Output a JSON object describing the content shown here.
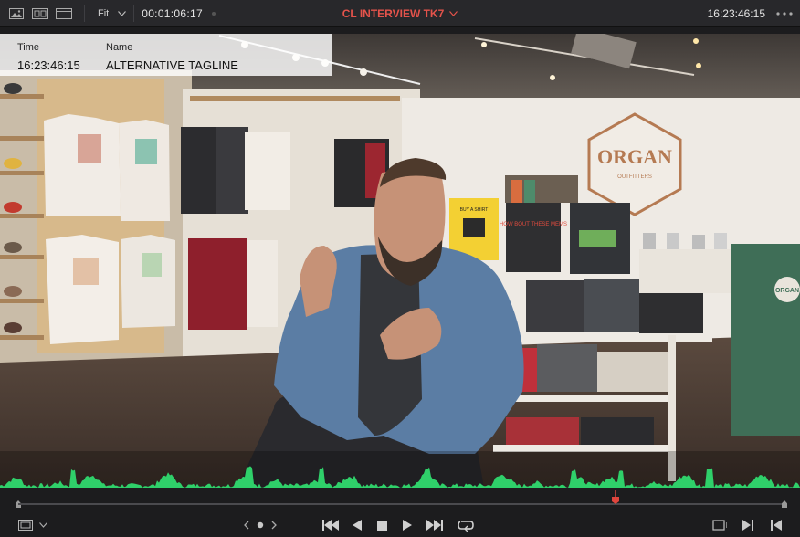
{
  "toolbar": {
    "zoom_label": "Fit",
    "source_timecode": "00:01:06:17",
    "clip_name": "CL INTERVIEW TK7",
    "record_timecode": "16:23:46:15"
  },
  "overlay": {
    "time_label": "Time",
    "time_value": "16:23:46:15",
    "name_label": "Name",
    "name_value": "ALTERNATIVE TAGLINE"
  },
  "scene": {
    "store_sign_main": "ORGAN",
    "store_sign_sub": "OUTFITTERS",
    "sign_buy_shirt": "BUY A SHIRT",
    "sign_how_about": "HOW BOUT THESE MEMS",
    "shirt_logo": "ORGAN"
  },
  "playback": {
    "playhead_position": 0.78
  },
  "colors": {
    "clip_title": "#e5534b",
    "waveform": "#2fd06a",
    "playhead": "#e0453d"
  },
  "icons": [
    "viewer-layout-icon",
    "image-wipe-icon",
    "film-strip-icon",
    "chevron-down-icon",
    "more-options-icon",
    "viewer-mode-icon",
    "jog-left-icon",
    "jog-dot-icon",
    "jog-right-icon",
    "skip-to-start-icon",
    "play-reverse-icon",
    "stop-icon",
    "play-icon",
    "skip-to-end-icon",
    "loop-icon",
    "match-frame-icon",
    "next-clip-icon",
    "prev-clip-icon"
  ]
}
